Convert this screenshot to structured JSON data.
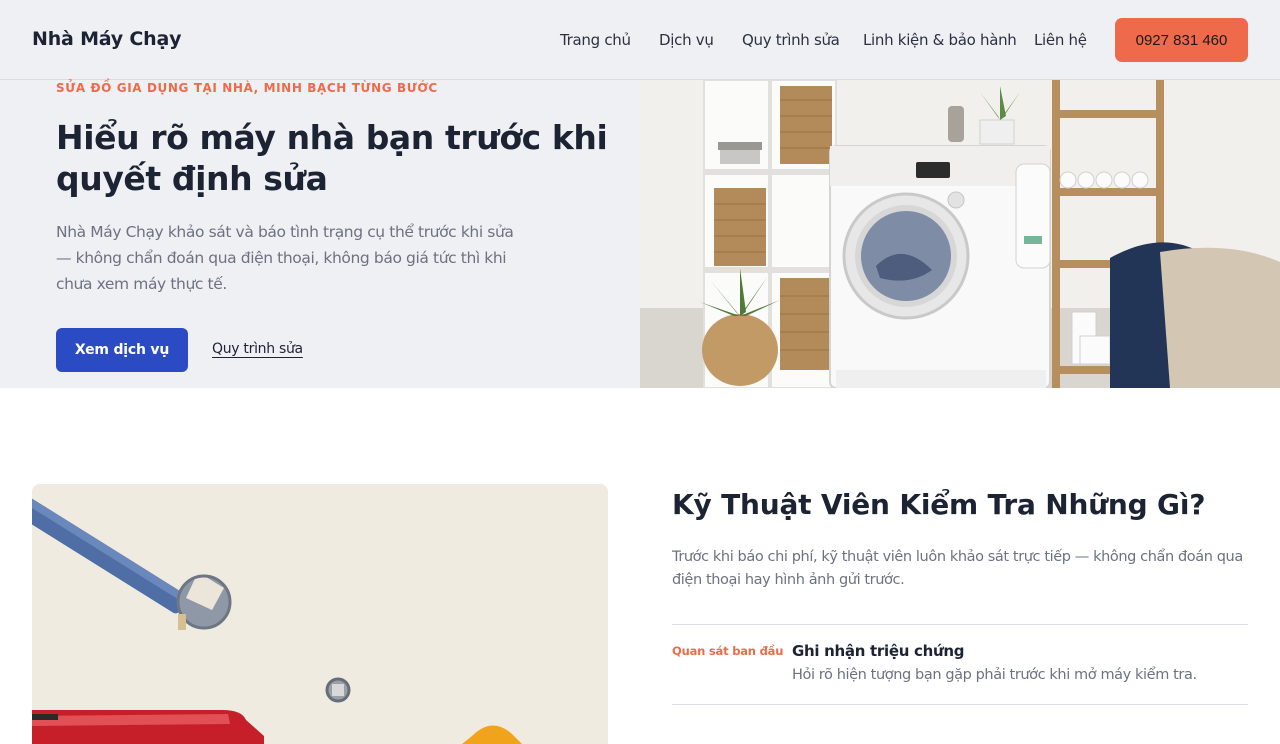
{
  "header": {
    "logo": "Nhà Máy Chạy",
    "nav": [
      "Trang chủ",
      "Dịch vụ",
      "Quy trình sửa",
      "Linh kiện & bảo hành",
      "Liên hệ"
    ],
    "phone": "0927 831 460"
  },
  "hero": {
    "eyebrow": "SỬA ĐỒ GIA DỤNG TẠI NHÀ, MINH BẠCH TỪNG BƯỚC",
    "title": "Hiểu rõ máy nhà bạn trước khi quyết định sửa",
    "description": "Nhà Máy Chạy khảo sát và báo tình trạng cụ thể trước khi sửa — không chẩn đoán qua điện thoại, không báo giá tức thì khi chưa xem máy thực tế.",
    "primary_button": "Xem dịch vụ",
    "secondary_link": "Quy trình sửa"
  },
  "section": {
    "title": "Kỹ Thuật Viên Kiểm Tra Những Gì?",
    "description": "Trước khi báo chi phí, kỹ thuật viên luôn khảo sát trực tiếp — không chẩn đoán qua điện thoại hay hình ảnh gửi trước.",
    "steps": [
      {
        "tag": "Quan sát ban đầu",
        "title": "Ghi nhận triệu chứng",
        "description": "Hỏi rõ hiện tượng bạn gặp phải trước khi mở máy kiểm tra."
      }
    ]
  },
  "colors": {
    "accent": "#ef6a4a",
    "primary": "#2a4bc4",
    "header_bg": "#eef0f4",
    "text_dark": "#1c2333",
    "text_muted": "#6d7280"
  }
}
